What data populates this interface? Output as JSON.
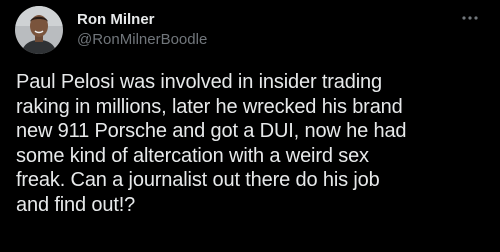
{
  "tweet": {
    "author": {
      "display_name": "Ron Milner",
      "handle": "@RonMilnerBoodle",
      "avatar_icon": "profile-photo"
    },
    "more_icon": "more-horizontal-icon",
    "text": "Paul Pelosi was involved in insider trading\nraking in millions, later he wrecked his brand\nnew 911 Porsche and got a DUI, now he had\nsome kind of altercation with a weird sex\nfreak. Can a journalist out there do his job\nand find out!?"
  },
  "colors": {
    "background": "#000000",
    "primary_text": "#e7e9ea",
    "secondary_text": "#71767b"
  }
}
